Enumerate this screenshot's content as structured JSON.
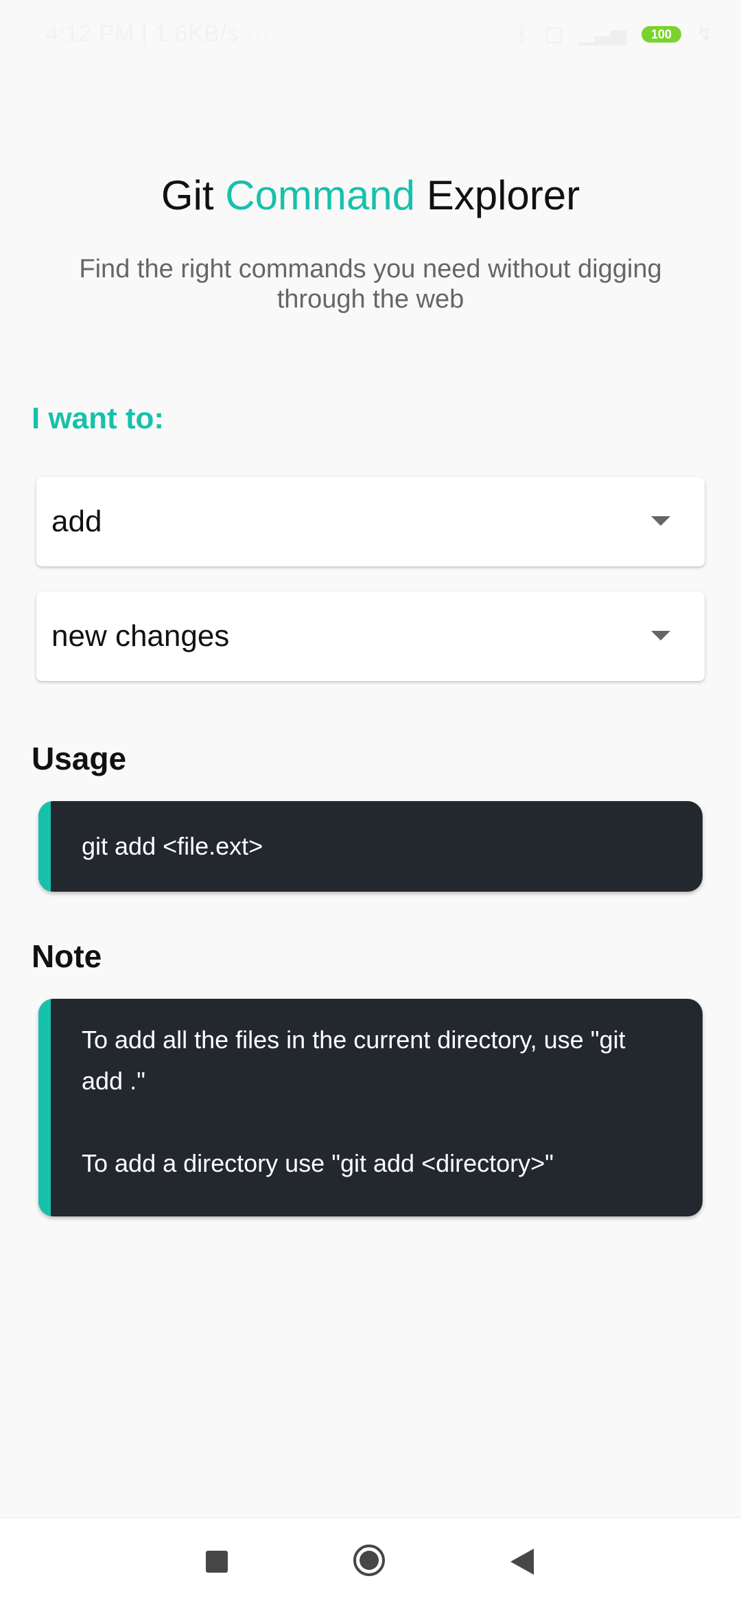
{
  "status_bar": {
    "time_info": "4:12 PM | 1.6KB/s",
    "more": "···",
    "battery": "100",
    "icons": [
      "bluetooth-icon",
      "alarm-icon",
      "signal-icon",
      "battery-icon",
      "charging-icon"
    ]
  },
  "header": {
    "title_part1": "Git",
    "title_accent": "Command",
    "title_part3": "Explorer",
    "subtitle": "Find the right commands you need without digging through the web",
    "accent_color": "#16c1ab"
  },
  "form": {
    "label": "I want to:",
    "select_action": "add",
    "select_target": "new changes"
  },
  "usage": {
    "title": "Usage",
    "command": "git add <file.ext>"
  },
  "note": {
    "title": "Note",
    "line1": "To add all the files in the current directory, use \"git add .\"",
    "line2": "To add a directory use \"git add <directory>\""
  },
  "nav": {
    "icons": [
      "recents-icon",
      "home-icon",
      "back-icon"
    ]
  }
}
